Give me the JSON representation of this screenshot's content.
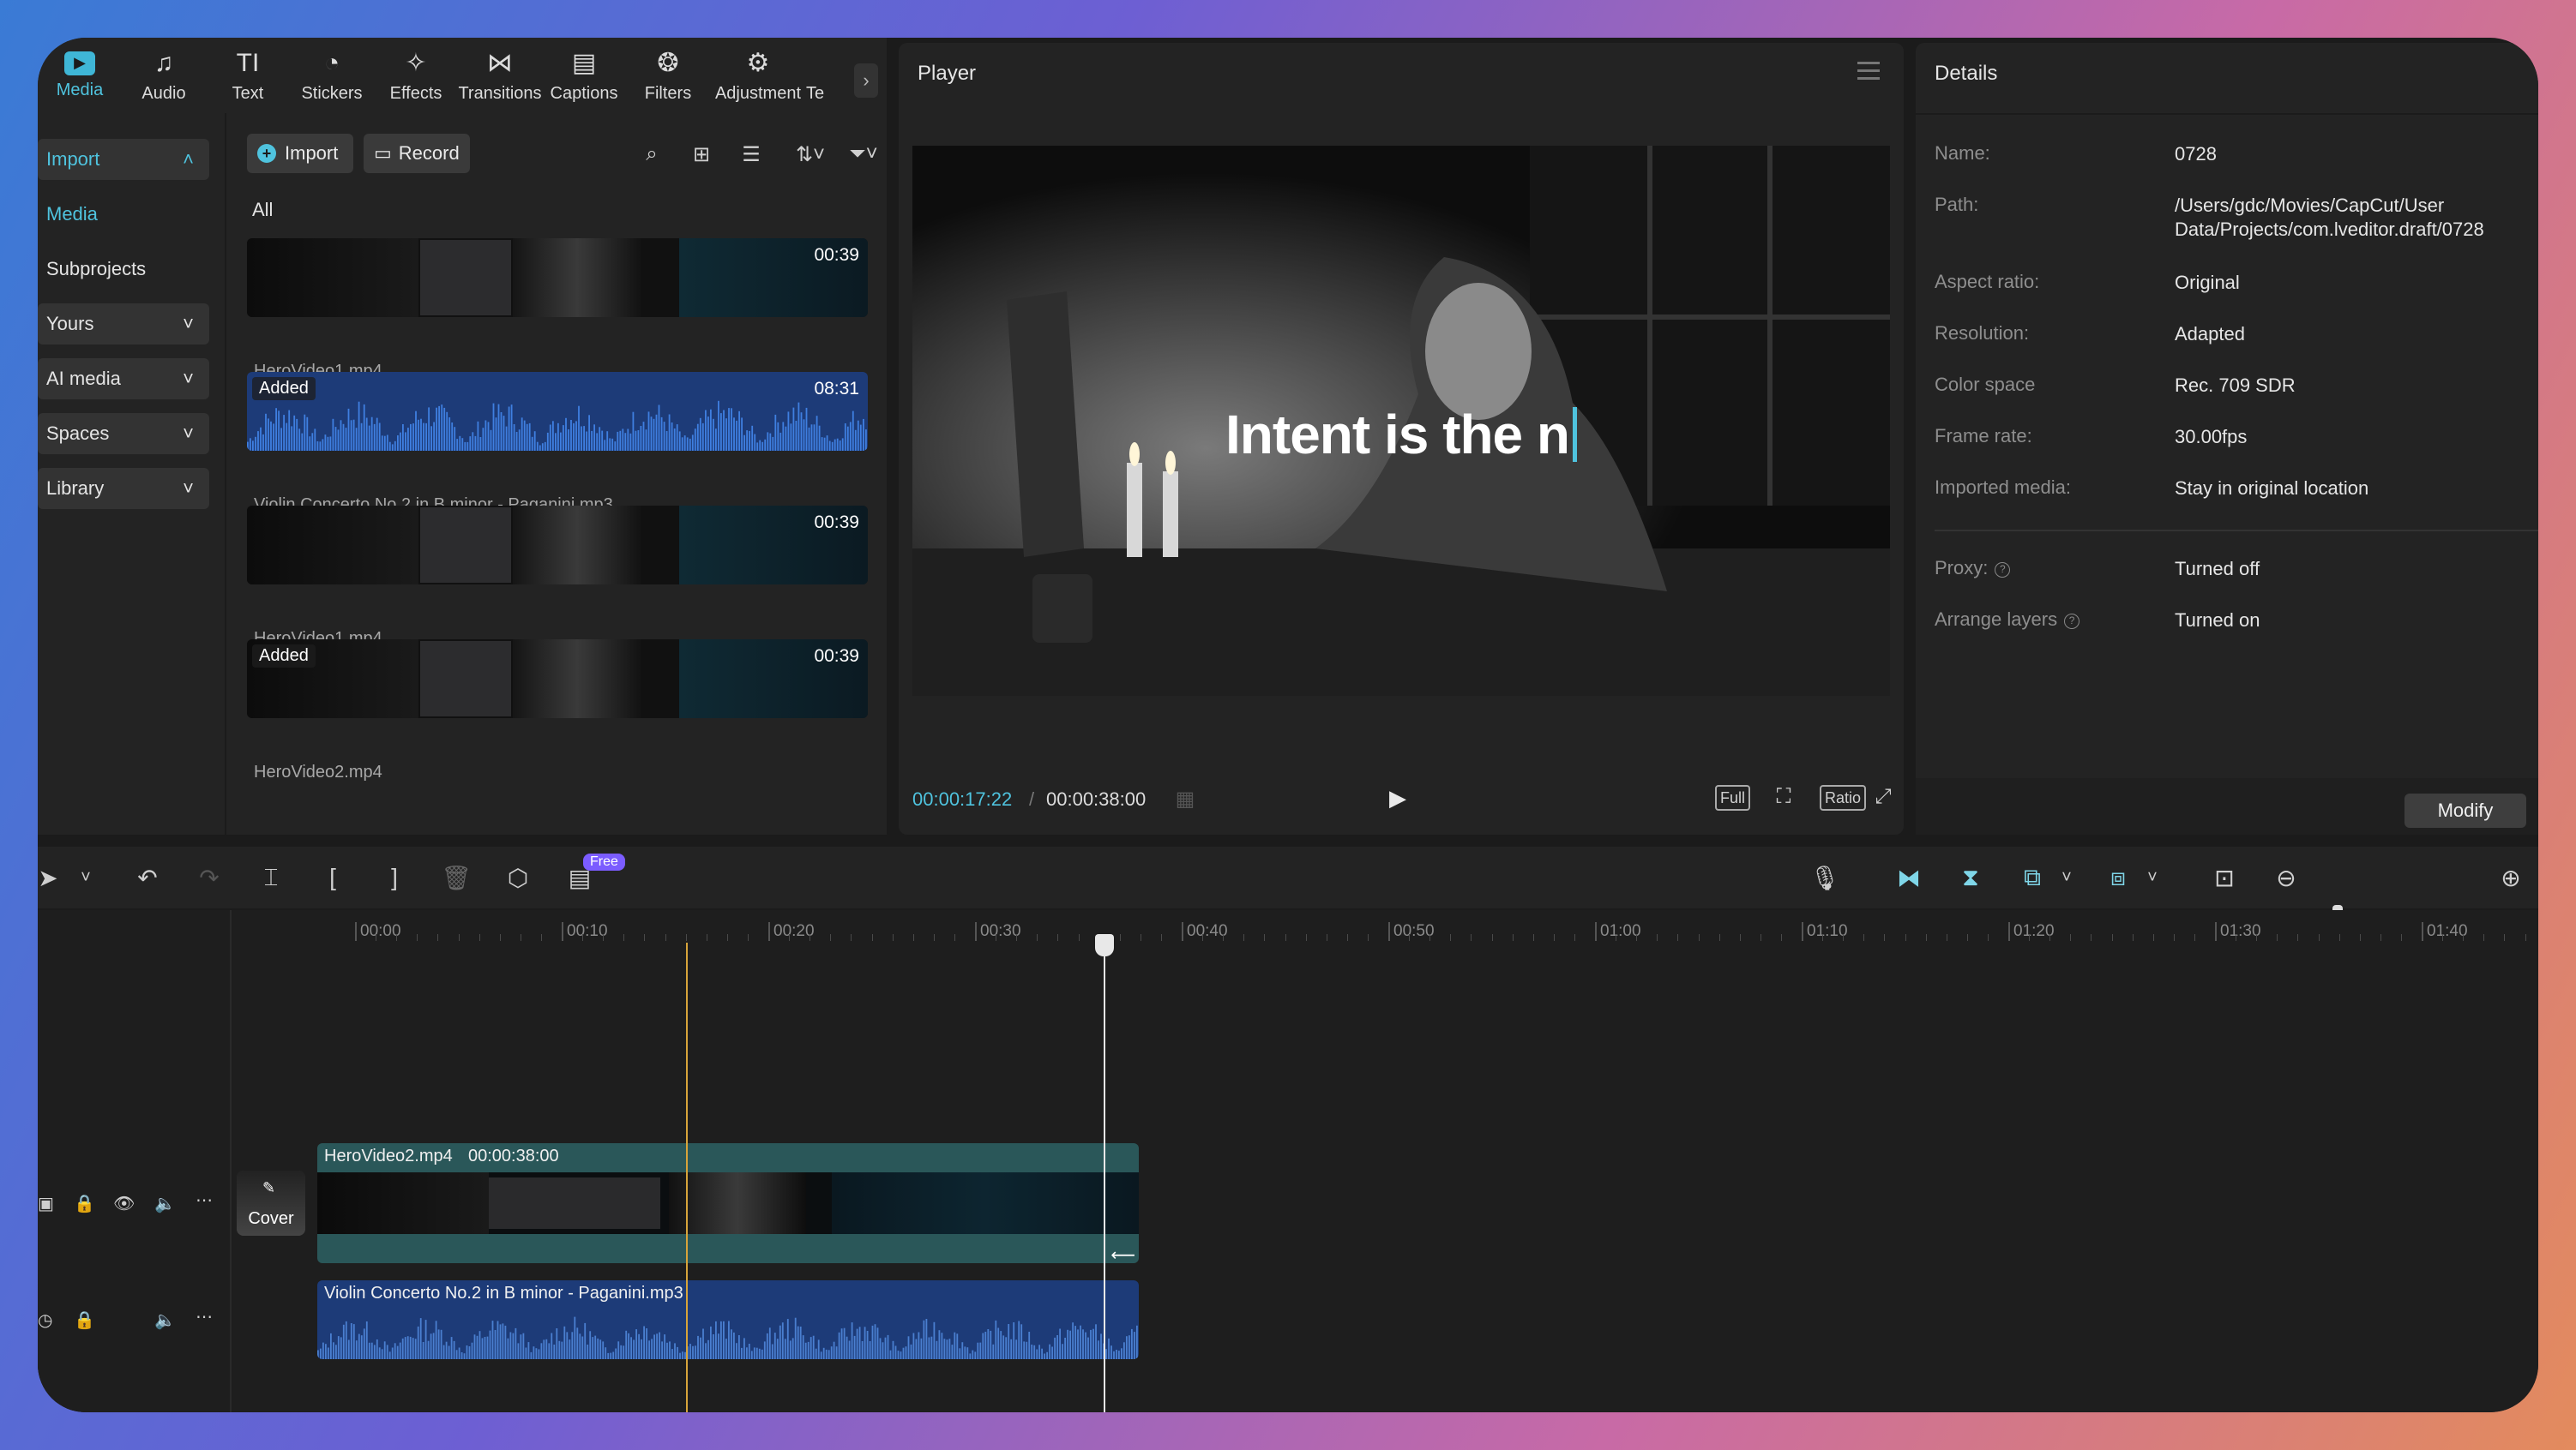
{
  "tabs": [
    {
      "label": "Media",
      "icon": "media-icon",
      "glyph": "▶"
    },
    {
      "label": "Audio",
      "icon": "audio-icon",
      "glyph": "♫"
    },
    {
      "label": "Text",
      "icon": "text-icon",
      "glyph": "TI"
    },
    {
      "label": "Stickers",
      "icon": "stickers-icon",
      "glyph": "◔"
    },
    {
      "label": "Effects",
      "icon": "effects-icon",
      "glyph": "✧"
    },
    {
      "label": "Transitions",
      "icon": "transitions-icon",
      "glyph": "⋈"
    },
    {
      "label": "Captions",
      "icon": "captions-icon",
      "glyph": "▤"
    },
    {
      "label": "Filters",
      "icon": "filters-icon",
      "glyph": "❂"
    },
    {
      "label": "Adjustment",
      "icon": "adjustment-icon",
      "glyph": "⚙"
    },
    {
      "label": "Te",
      "icon": "template-icon",
      "glyph": ""
    }
  ],
  "leftnav": {
    "import": "Import",
    "media": "Media",
    "subprojects": "Subprojects",
    "yours": "Yours",
    "ai_media": "AI media",
    "spaces": "Spaces",
    "library": "Library"
  },
  "media_toolbar": {
    "import": "Import",
    "record": "Record",
    "all": "All"
  },
  "clips": [
    {
      "name": "HeroVideo1.mp4",
      "duration": "00:39",
      "added": ""
    },
    {
      "name": "Violin Concerto No.2 in B minor - Paganini.mp3",
      "duration": "08:31",
      "added": "Added"
    },
    {
      "name": "HeroVideo1.mp4",
      "duration": "00:39",
      "added": ""
    },
    {
      "name": "HeroVideo2.mp4",
      "duration": "00:39",
      "added": "Added"
    }
  ],
  "player": {
    "title": "Player",
    "caption": "Intent is the n",
    "time_current": "00:00:17:22",
    "time_separator": "/",
    "time_total": "00:00:38:00",
    "full": "Full",
    "ratio": "Ratio"
  },
  "details": {
    "title": "Details",
    "rows": [
      {
        "key": "Name:",
        "value": "0728"
      },
      {
        "key": "Path:",
        "value": "/Users/gdc/Movies/CapCut/User Data/Projects/com.lveditor.draft/0728"
      },
      {
        "key": "Aspect ratio:",
        "value": "Original"
      },
      {
        "key": "Resolution:",
        "value": "Adapted"
      },
      {
        "key": "Color space",
        "value": "Rec. 709 SDR"
      },
      {
        "key": "Frame rate:",
        "value": "30.00fps"
      },
      {
        "key": "Imported media:",
        "value": "Stay in original location"
      },
      {
        "key": "Proxy:",
        "value": "Turned off"
      },
      {
        "key": "Arrange layers",
        "value": "Turned on"
      }
    ],
    "modify": "Modify"
  },
  "timeline": {
    "free_badge": "Free",
    "ruler": [
      "00:00",
      "00:10",
      "00:20",
      "00:30",
      "00:40",
      "00:50",
      "01:00",
      "01:10",
      "01:20",
      "01:30",
      "01:40"
    ],
    "video_track": {
      "name": "HeroVideo2.mp4",
      "duration": "00:00:38:00"
    },
    "audio_track": {
      "name": "Violin Concerto No.2 in B minor - Paganini.mp3"
    },
    "cover": "Cover",
    "zoom_level": 0.05
  },
  "colors": {
    "accent": "#4fc3de",
    "video_track": "#2a5759",
    "audio_track": "#1d3b78",
    "playhead_in": "#d7a43a"
  }
}
